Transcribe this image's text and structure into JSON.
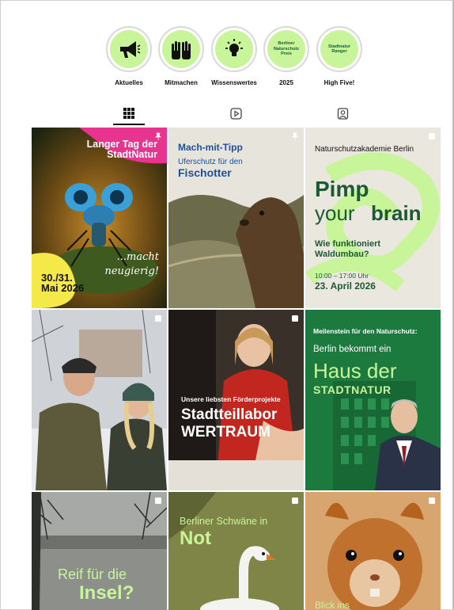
{
  "highlights": [
    {
      "label": "Aktuelles",
      "icon": "megaphone-icon"
    },
    {
      "label": "Mitmachen",
      "icon": "raised-hands-icon"
    },
    {
      "label": "Wissenswertes",
      "icon": "lightbulb-icon"
    },
    {
      "label": "2025",
      "icon": "text-badge",
      "badge": "Berliner\nNaturschutz\nPreis"
    },
    {
      "label": "High Five!",
      "icon": "text-badge",
      "badge": "Stadtnatur\nRanger"
    }
  ],
  "tabs": [
    {
      "name": "posts",
      "icon": "grid-icon",
      "active": true
    },
    {
      "name": "reels",
      "icon": "reels-icon",
      "active": false
    },
    {
      "name": "tagged",
      "icon": "tagged-icon",
      "active": false
    }
  ],
  "posts": {
    "p1": {
      "title": "Langer Tag der\nStadtNatur",
      "date": "30./31.\nMai 2026",
      "script": "...macht\nneugierig!",
      "marker": "pin-icon"
    },
    "p2": {
      "kicker": "Mach-mit-Tipp",
      "line1": "Uferschutz für den",
      "line2": "Fischotter",
      "marker": "pin-icon"
    },
    "p3": {
      "org": "Naturschutzakademie Berlin",
      "w1": "Pimp",
      "w2": "your",
      "w3": "brain",
      "question": "Wie funktioniert\nWaldumbau?",
      "time": "10:00 – 17:00 Uhr",
      "date": "23. April 2026",
      "marker": "carousel-icon"
    },
    "p4": {
      "marker": "carousel-icon"
    },
    "p5": {
      "caption": "Unsere liebsten Förderprojekte",
      "l1": "Stadtteillabor",
      "l2": "WERTRAUM",
      "marker": "carousel-icon"
    },
    "p6": {
      "kicker": "Meilenstein für den Naturschutz:",
      "intro": "Berlin bekommt ein",
      "big": "Haus der",
      "sub": "STADTNATUR",
      "marker": "carousel-icon"
    },
    "p7": {
      "l1": "Reif für die",
      "l2": "Insel?",
      "marker": "carousel-icon"
    },
    "p8": {
      "l1": "Berliner Schwäne in",
      "l2": "Not",
      "marker": "carousel-icon"
    },
    "p9": {
      "l1": "Blick ins",
      "marker": "carousel-icon"
    }
  },
  "colors": {
    "accent_green": "#c9f59a",
    "dark_green": "#1a5a34",
    "pink": "#e8338f",
    "yellow": "#f5e94a"
  }
}
